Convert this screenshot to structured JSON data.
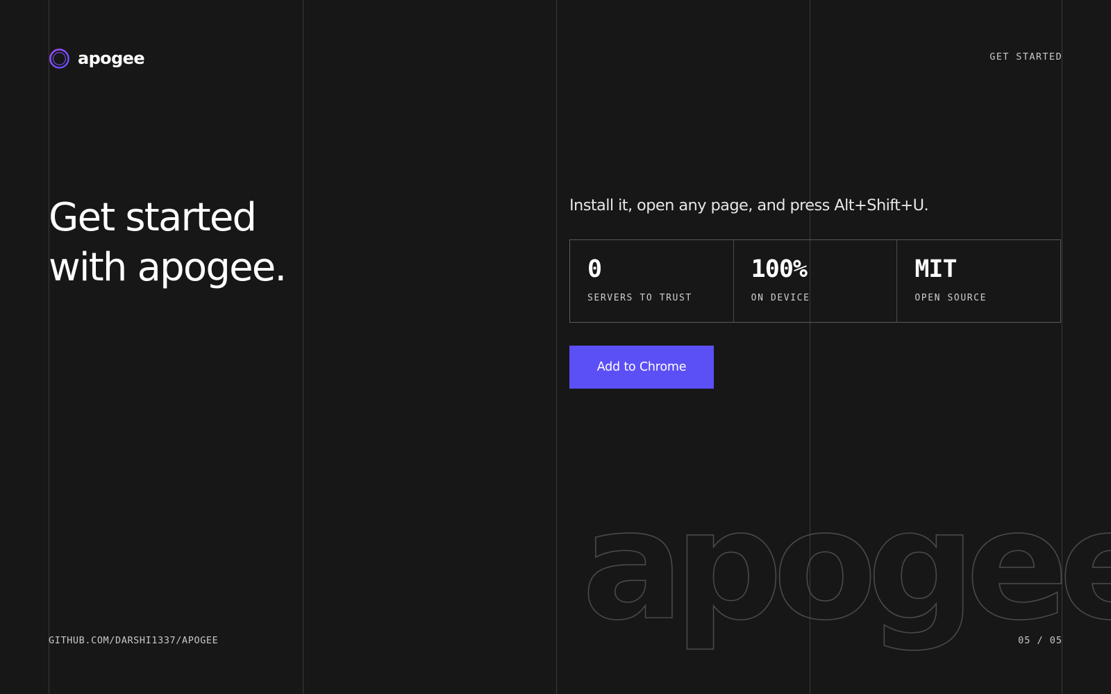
{
  "brand": {
    "name": "apogee",
    "icon": "ring-logo-icon",
    "accent_color": "#7c4dff"
  },
  "nav": {
    "get_started_label": "GET STARTED"
  },
  "hero": {
    "headline_line1": "Get started",
    "headline_line2": "with apogee."
  },
  "install": {
    "tagline": "Install it, open any page, and press Alt+Shift+U."
  },
  "stats": [
    {
      "value": "0",
      "label": "SERVERS TO TRUST"
    },
    {
      "value": "100%",
      "label": "ON DEVICE"
    },
    {
      "value": "MIT",
      "label": "OPEN SOURCE"
    }
  ],
  "cta": {
    "label": "Add to Chrome",
    "color": "#5b4ff6"
  },
  "watermark": {
    "text": "apogee"
  },
  "footer": {
    "repo_link": "GITHUB.COM/DARSHI1337/APOGEE",
    "pager": "05 / 05"
  }
}
